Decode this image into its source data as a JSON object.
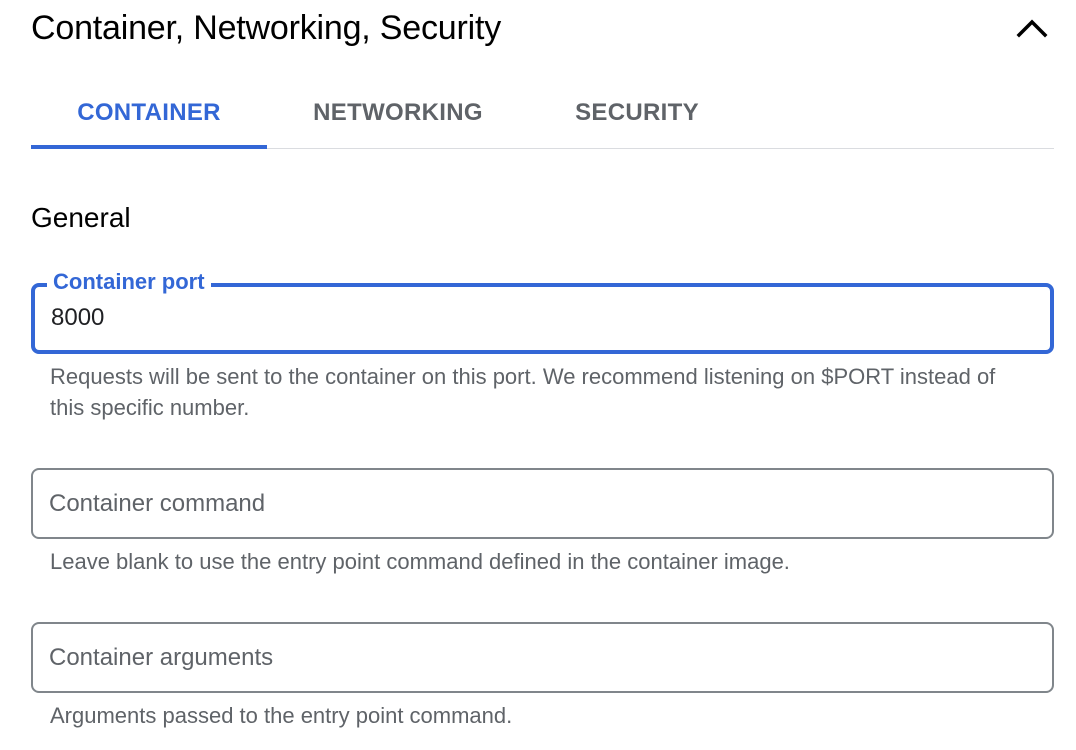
{
  "section": {
    "title": "Container, Networking, Security",
    "collapse_icon": "chevron-up-icon"
  },
  "tabs": [
    {
      "label": "CONTAINER",
      "active": true
    },
    {
      "label": "NETWORKING",
      "active": false
    },
    {
      "label": "SECURITY",
      "active": false
    }
  ],
  "general": {
    "heading": "General",
    "container_port": {
      "label": "Container port",
      "value": "8000",
      "helper": "Requests will be sent to the container on this port. We recommend listening on $PORT instead of this specific number."
    },
    "container_command": {
      "placeholder": "Container command",
      "value": "",
      "helper": "Leave blank to use the entry point command defined in the container image."
    },
    "container_arguments": {
      "placeholder": "Container arguments",
      "value": "",
      "helper": "Arguments passed to the entry point command."
    }
  },
  "colors": {
    "accent": "#3367d6",
    "text_secondary": "#5f6368",
    "border": "#80868b",
    "divider": "#dadce0"
  }
}
